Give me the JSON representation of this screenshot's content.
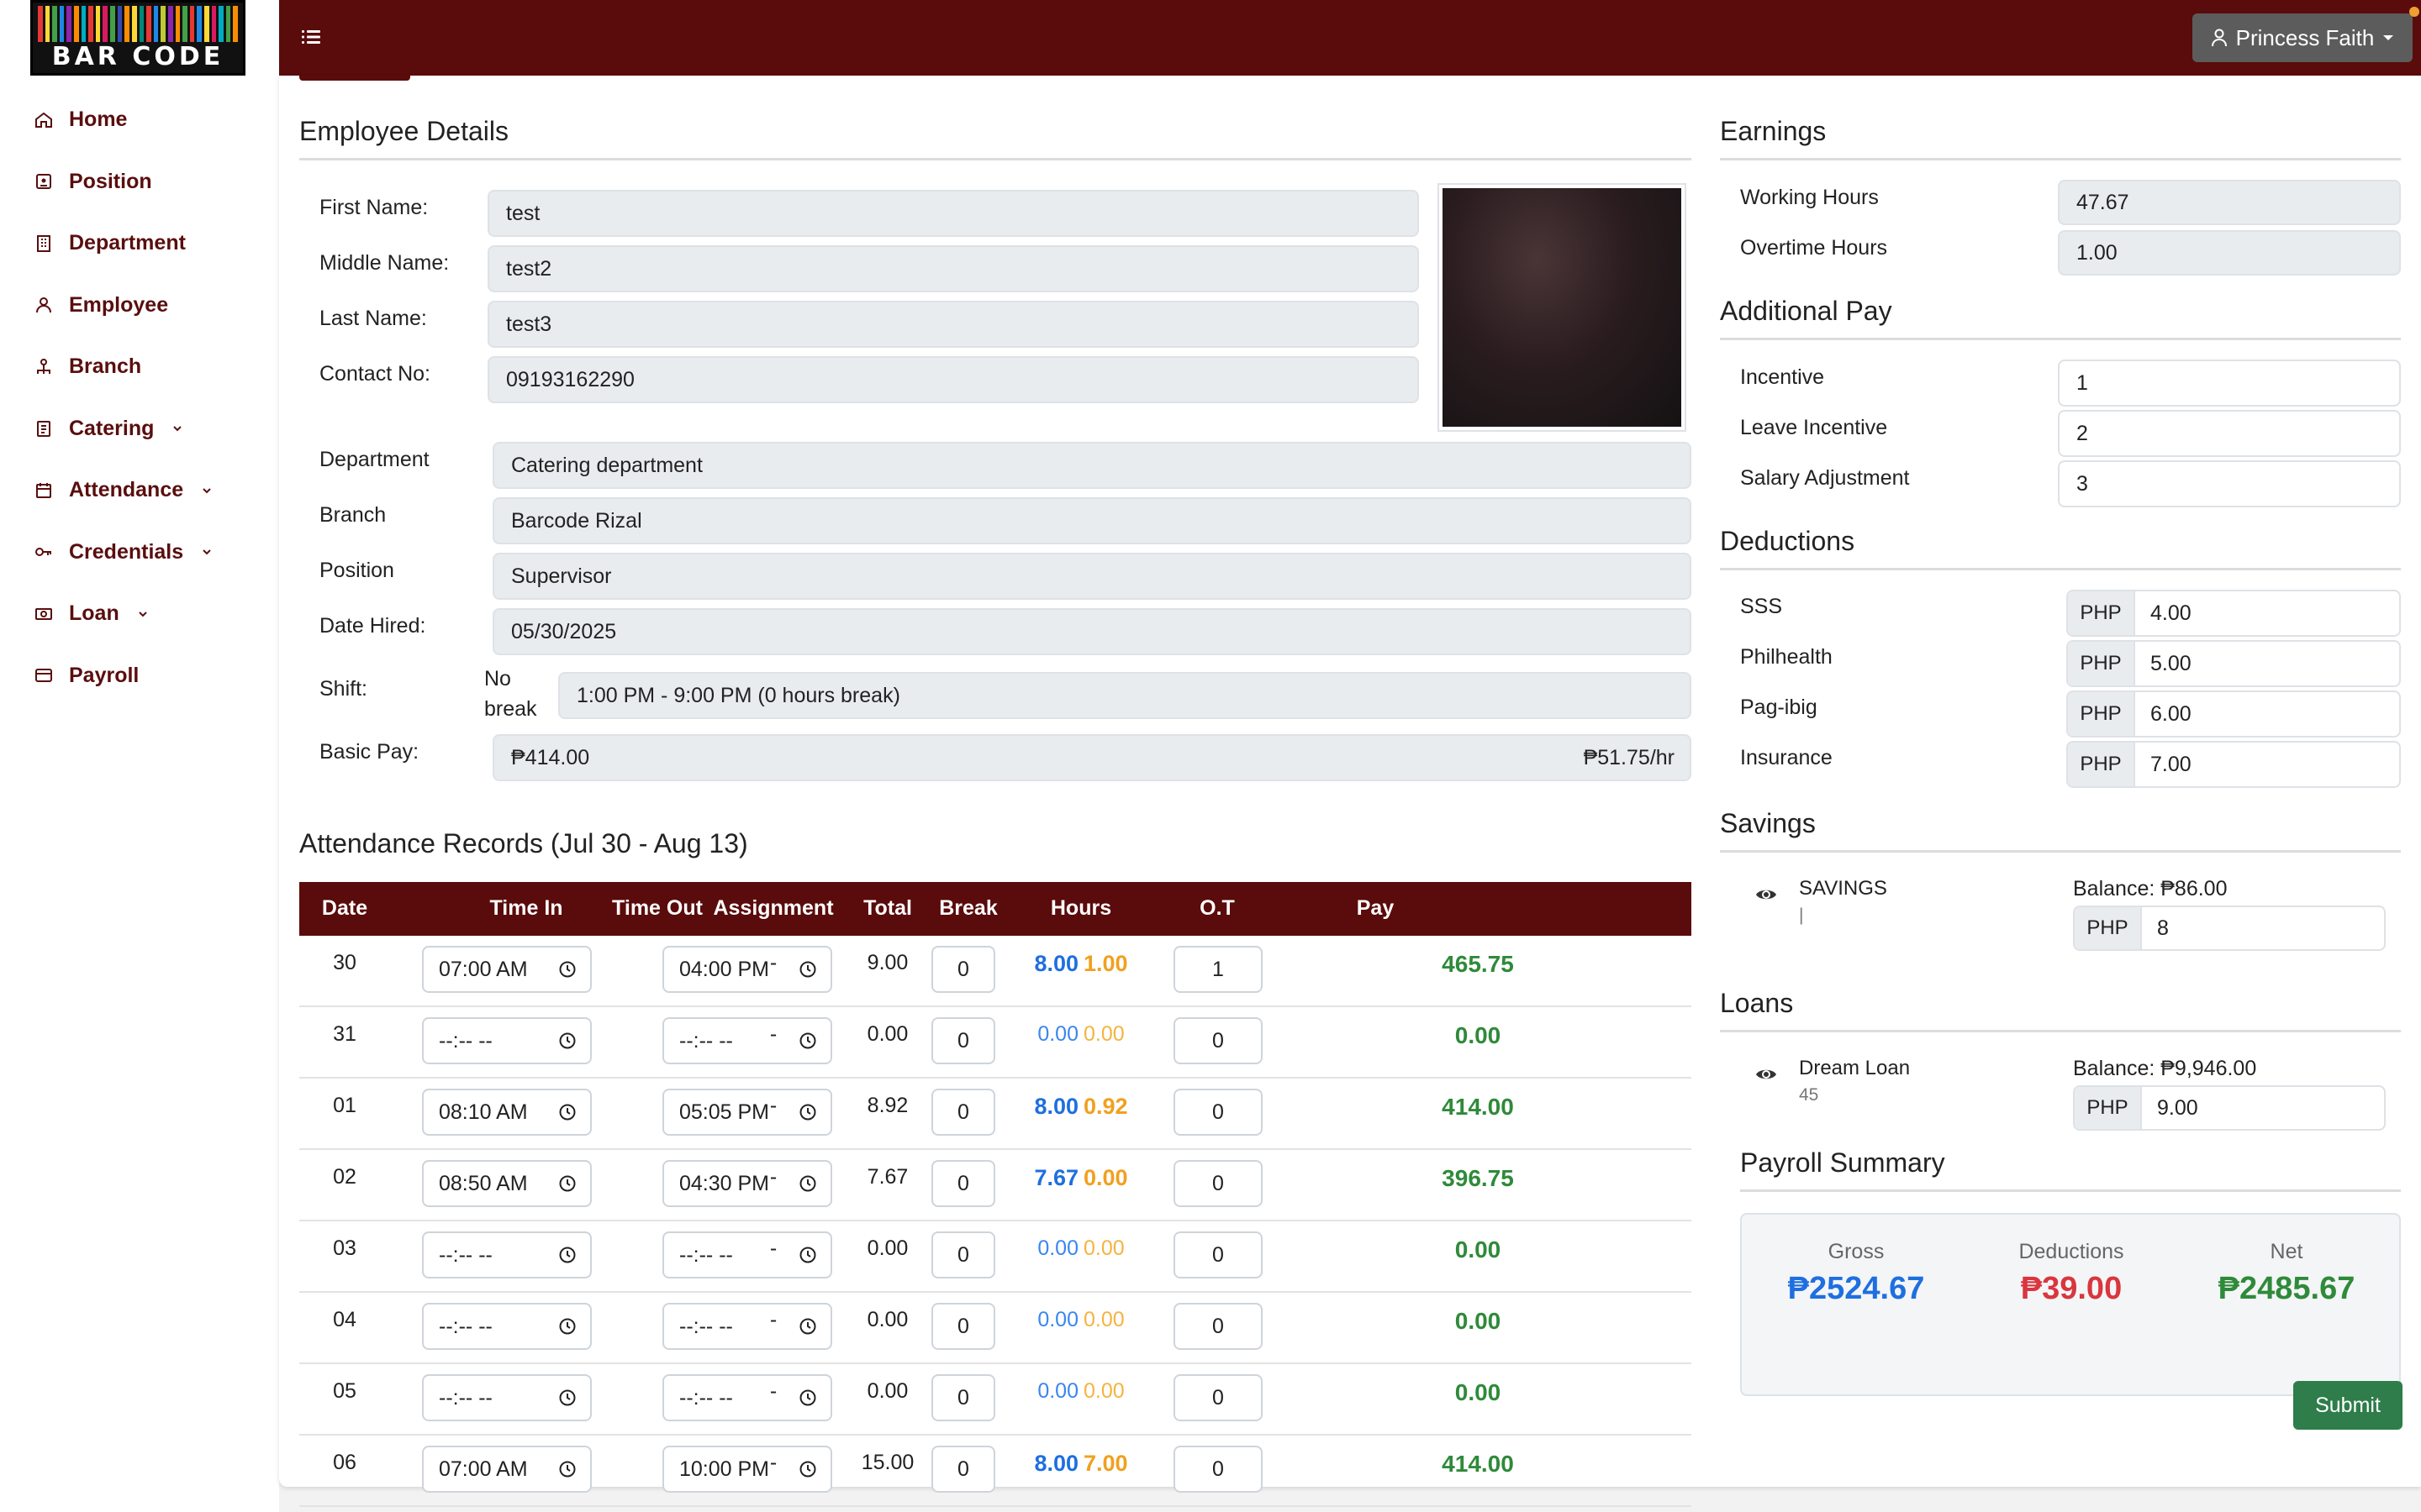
{
  "logo": {
    "text": "BAR CODE"
  },
  "sidebar": {
    "items": [
      {
        "label": "Home",
        "icon": "home-icon",
        "dropdown": false
      },
      {
        "label": "Position",
        "icon": "position-icon",
        "dropdown": false
      },
      {
        "label": "Department",
        "icon": "building-icon",
        "dropdown": false
      },
      {
        "label": "Employee",
        "icon": "user-icon",
        "dropdown": false
      },
      {
        "label": "Branch",
        "icon": "branch-icon",
        "dropdown": false
      },
      {
        "label": "Catering",
        "icon": "clipboard-icon",
        "dropdown": true
      },
      {
        "label": "Attendance",
        "icon": "calendar-icon",
        "dropdown": true
      },
      {
        "label": "Credentials",
        "icon": "key-icon",
        "dropdown": true
      },
      {
        "label": "Loan",
        "icon": "loan-icon",
        "dropdown": true
      },
      {
        "label": "Payroll",
        "icon": "card-icon",
        "dropdown": false
      }
    ]
  },
  "header": {
    "user_name": "Princess Faith"
  },
  "employee": {
    "title": "Employee Details",
    "first_name_label": "First Name:",
    "first_name": "test",
    "middle_name_label": "Middle Name:",
    "middle_name": "test2",
    "last_name_label": "Last Name:",
    "last_name": "test3",
    "contact_label": "Contact No:",
    "contact": "09193162290",
    "department_label": "Department",
    "department": "Catering department",
    "branch_label": "Branch",
    "branch": "Barcode Rizal",
    "position_label": "Position",
    "position": "Supervisor",
    "date_hired_label": "Date Hired:",
    "date_hired": "05/30/2025",
    "shift_label": "Shift:",
    "shift_note_1": "No",
    "shift_note_2": "break",
    "shift": "1:00 PM - 9:00 PM (0 hours break)",
    "basic_pay_label": "Basic Pay:",
    "basic_pay": "₱414.00",
    "hourly_rate": "₱51.75/hr"
  },
  "attendance": {
    "title": "Attendance Records (Jul 30 - Aug 13)",
    "columns": [
      "Date",
      "Time In",
      "Time Out",
      "Assignment",
      "Total",
      "Break",
      "Hours",
      "O.T",
      "Pay"
    ],
    "rows": [
      {
        "date": "30",
        "time_in": "07:00 AM",
        "time_out": "04:00 PM",
        "assignment": "-",
        "total": "9.00",
        "break": "0",
        "hours": "8.00",
        "ot_hours": "1.00",
        "ot": "1",
        "pay": "465.75",
        "emph": true
      },
      {
        "date": "31",
        "time_in": "--:-- --",
        "time_out": "--:-- --",
        "assignment": "-",
        "total": "0.00",
        "break": "0",
        "hours": "0.00",
        "ot_hours": "0.00",
        "ot": "0",
        "pay": "0.00",
        "emph": false
      },
      {
        "date": "01",
        "time_in": "08:10 AM",
        "time_out": "05:05 PM",
        "assignment": "-",
        "total": "8.92",
        "break": "0",
        "hours": "8.00",
        "ot_hours": "0.92",
        "ot": "0",
        "pay": "414.00",
        "emph": true
      },
      {
        "date": "02",
        "time_in": "08:50 AM",
        "time_out": "04:30 PM",
        "assignment": "-",
        "total": "7.67",
        "break": "0",
        "hours": "7.67",
        "ot_hours": "0.00",
        "ot": "0",
        "pay": "396.75",
        "emph": true
      },
      {
        "date": "03",
        "time_in": "--:-- --",
        "time_out": "--:-- --",
        "assignment": "-",
        "total": "0.00",
        "break": "0",
        "hours": "0.00",
        "ot_hours": "0.00",
        "ot": "0",
        "pay": "0.00",
        "emph": false
      },
      {
        "date": "04",
        "time_in": "--:-- --",
        "time_out": "--:-- --",
        "assignment": "-",
        "total": "0.00",
        "break": "0",
        "hours": "0.00",
        "ot_hours": "0.00",
        "ot": "0",
        "pay": "0.00",
        "emph": false
      },
      {
        "date": "05",
        "time_in": "--:-- --",
        "time_out": "--:-- --",
        "assignment": "-",
        "total": "0.00",
        "break": "0",
        "hours": "0.00",
        "ot_hours": "0.00",
        "ot": "0",
        "pay": "0.00",
        "emph": false
      },
      {
        "date": "06",
        "time_in": "07:00 AM",
        "time_out": "10:00 PM",
        "assignment": "-",
        "total": "15.00",
        "break": "0",
        "hours": "8.00",
        "ot_hours": "7.00",
        "ot": "0",
        "pay": "414.00",
        "emph": true
      }
    ]
  },
  "earnings": {
    "title": "Earnings",
    "working_hours_label": "Working Hours",
    "working_hours": "47.67",
    "overtime_hours_label": "Overtime Hours",
    "overtime_hours": "1.00"
  },
  "additional_pay": {
    "title": "Additional Pay",
    "incentive_label": "Incentive",
    "incentive": "1",
    "leave_incentive_label": "Leave Incentive",
    "leave_incentive": "2",
    "salary_adjustment_label": "Salary Adjustment",
    "salary_adjustment": "3"
  },
  "deductions": {
    "title": "Deductions",
    "currency": "PHP",
    "sss_label": "SSS",
    "sss": "4.00",
    "philhealth_label": "Philhealth",
    "philhealth": "5.00",
    "pagibig_label": "Pag-ibig",
    "pagibig": "6.00",
    "insurance_label": "Insurance",
    "insurance": "7.00"
  },
  "savings": {
    "title": "Savings",
    "name": "SAVINGS",
    "sub": "|",
    "balance": "Balance: ₱86.00",
    "currency": "PHP",
    "amount": "8"
  },
  "loans": {
    "title": "Loans",
    "name": "Dream Loan",
    "sub": "45",
    "balance": "Balance: ₱9,946.00",
    "currency": "PHP",
    "amount": "9.00"
  },
  "summary": {
    "title": "Payroll Summary",
    "gross_label": "Gross",
    "gross": "₱2524.67",
    "deductions_label": "Deductions",
    "deductions": "₱39.00",
    "net_label": "Net",
    "net": "₱2485.67"
  },
  "actions": {
    "submit": "Submit"
  },
  "colors": {
    "brand": "#5a0b0b",
    "regular_hours": "#1e6fe0",
    "overtime": "#f0a020",
    "pay": "#2f8a3a",
    "deduction": "#d9363e",
    "submit": "#2e7d4a"
  }
}
